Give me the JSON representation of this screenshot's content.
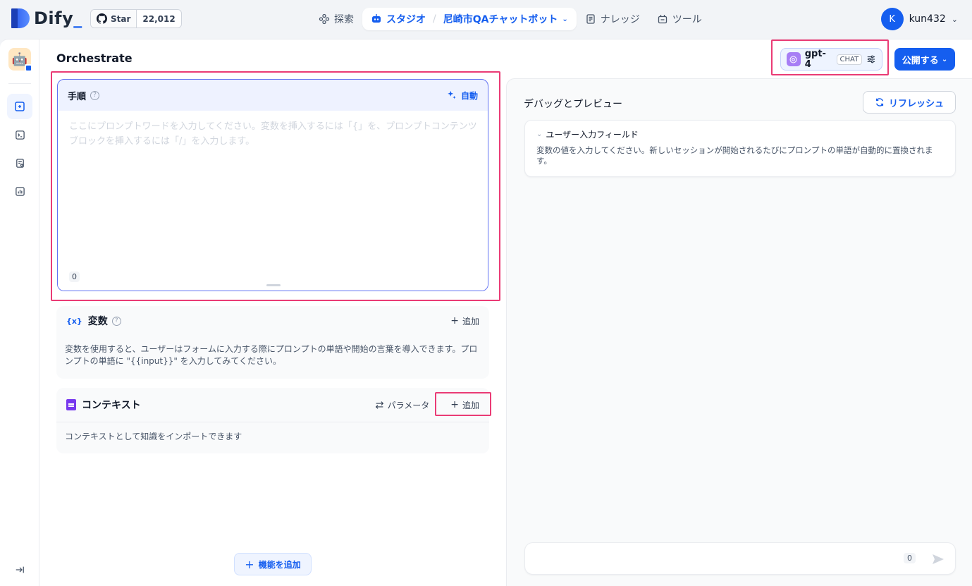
{
  "header": {
    "logo_text": "Dify",
    "github": {
      "star_label": "Star",
      "star_count": "22,012"
    },
    "nav": {
      "explore": "探索",
      "studio": "スタジオ",
      "separator": "/",
      "app_name": "尼崎市QAチャットボット",
      "knowledge": "ナレッジ",
      "tools": "ツール"
    },
    "user": {
      "initial": "K",
      "name": "kun432"
    }
  },
  "orchestrate": {
    "title": "Orchestrate",
    "model": {
      "name": "gpt-4",
      "mode_tag": "CHAT"
    },
    "publish_label": "公開する",
    "prompt": {
      "title": "手順",
      "auto_label": "自動",
      "placeholder": "ここにプロンプトワードを入力してください。変数を挿入するには「{」を、プロンプトコンテンツブロックを挿入するには「/」を入力します。",
      "char_count": "0"
    },
    "variables": {
      "icon_text": "{x}",
      "title": "変数",
      "add_label": "追加",
      "description": "変数を使用すると、ユーザーはフォームに入力する際にプロンプトの単語や開始の言葉を導入できます。プロンプトの単語に \"{{input}}\" を入力してみてください。"
    },
    "context": {
      "title": "コンテキスト",
      "params_label": "パラメータ",
      "add_label": "追加",
      "description": "コンテキストとして知識をインポートできます"
    },
    "add_feature_label": "機能を追加"
  },
  "debug": {
    "title": "デバッグとプレビュー",
    "refresh_label": "リフレッシュ",
    "input_fields": {
      "title": "ユーザー入力フィールド",
      "description": "変数の値を入力してください。新しいセッションが開始されるたびにプロンプトの単語が自動的に置換されます。"
    },
    "chat_char_count": "0"
  },
  "colors": {
    "accent": "#155eef",
    "highlight": "#ea3b75",
    "context_icon": "#7839ee",
    "model_logo": "#a77ef5"
  }
}
